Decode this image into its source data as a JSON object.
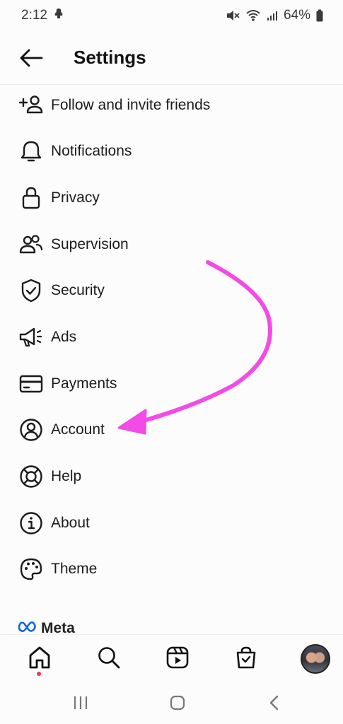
{
  "status_bar": {
    "time": "2:12",
    "battery": "64%"
  },
  "header": {
    "title": "Settings"
  },
  "menu": [
    {
      "label": "Follow and invite friends",
      "icon": "add-person-icon"
    },
    {
      "label": "Notifications",
      "icon": "bell-icon"
    },
    {
      "label": "Privacy",
      "icon": "lock-icon"
    },
    {
      "label": "Supervision",
      "icon": "people-icon"
    },
    {
      "label": "Security",
      "icon": "shield-check-icon"
    },
    {
      "label": "Ads",
      "icon": "megaphone-icon"
    },
    {
      "label": "Payments",
      "icon": "card-icon"
    },
    {
      "label": "Account",
      "icon": "account-circle-icon"
    },
    {
      "label": "Help",
      "icon": "lifebuoy-icon"
    },
    {
      "label": "About",
      "icon": "info-icon"
    },
    {
      "label": "Theme",
      "icon": "palette-icon"
    }
  ],
  "footer": {
    "meta_label": "Meta"
  },
  "tab_bar": {
    "tabs": [
      "home-icon",
      "search-icon",
      "reels-icon",
      "shop-icon",
      "profile-avatar"
    ],
    "active": "home-icon"
  },
  "colors": {
    "annotation_arrow": "#f24be6",
    "notification_dot": "#ff2d55",
    "meta_blue": "#0a66e0"
  }
}
